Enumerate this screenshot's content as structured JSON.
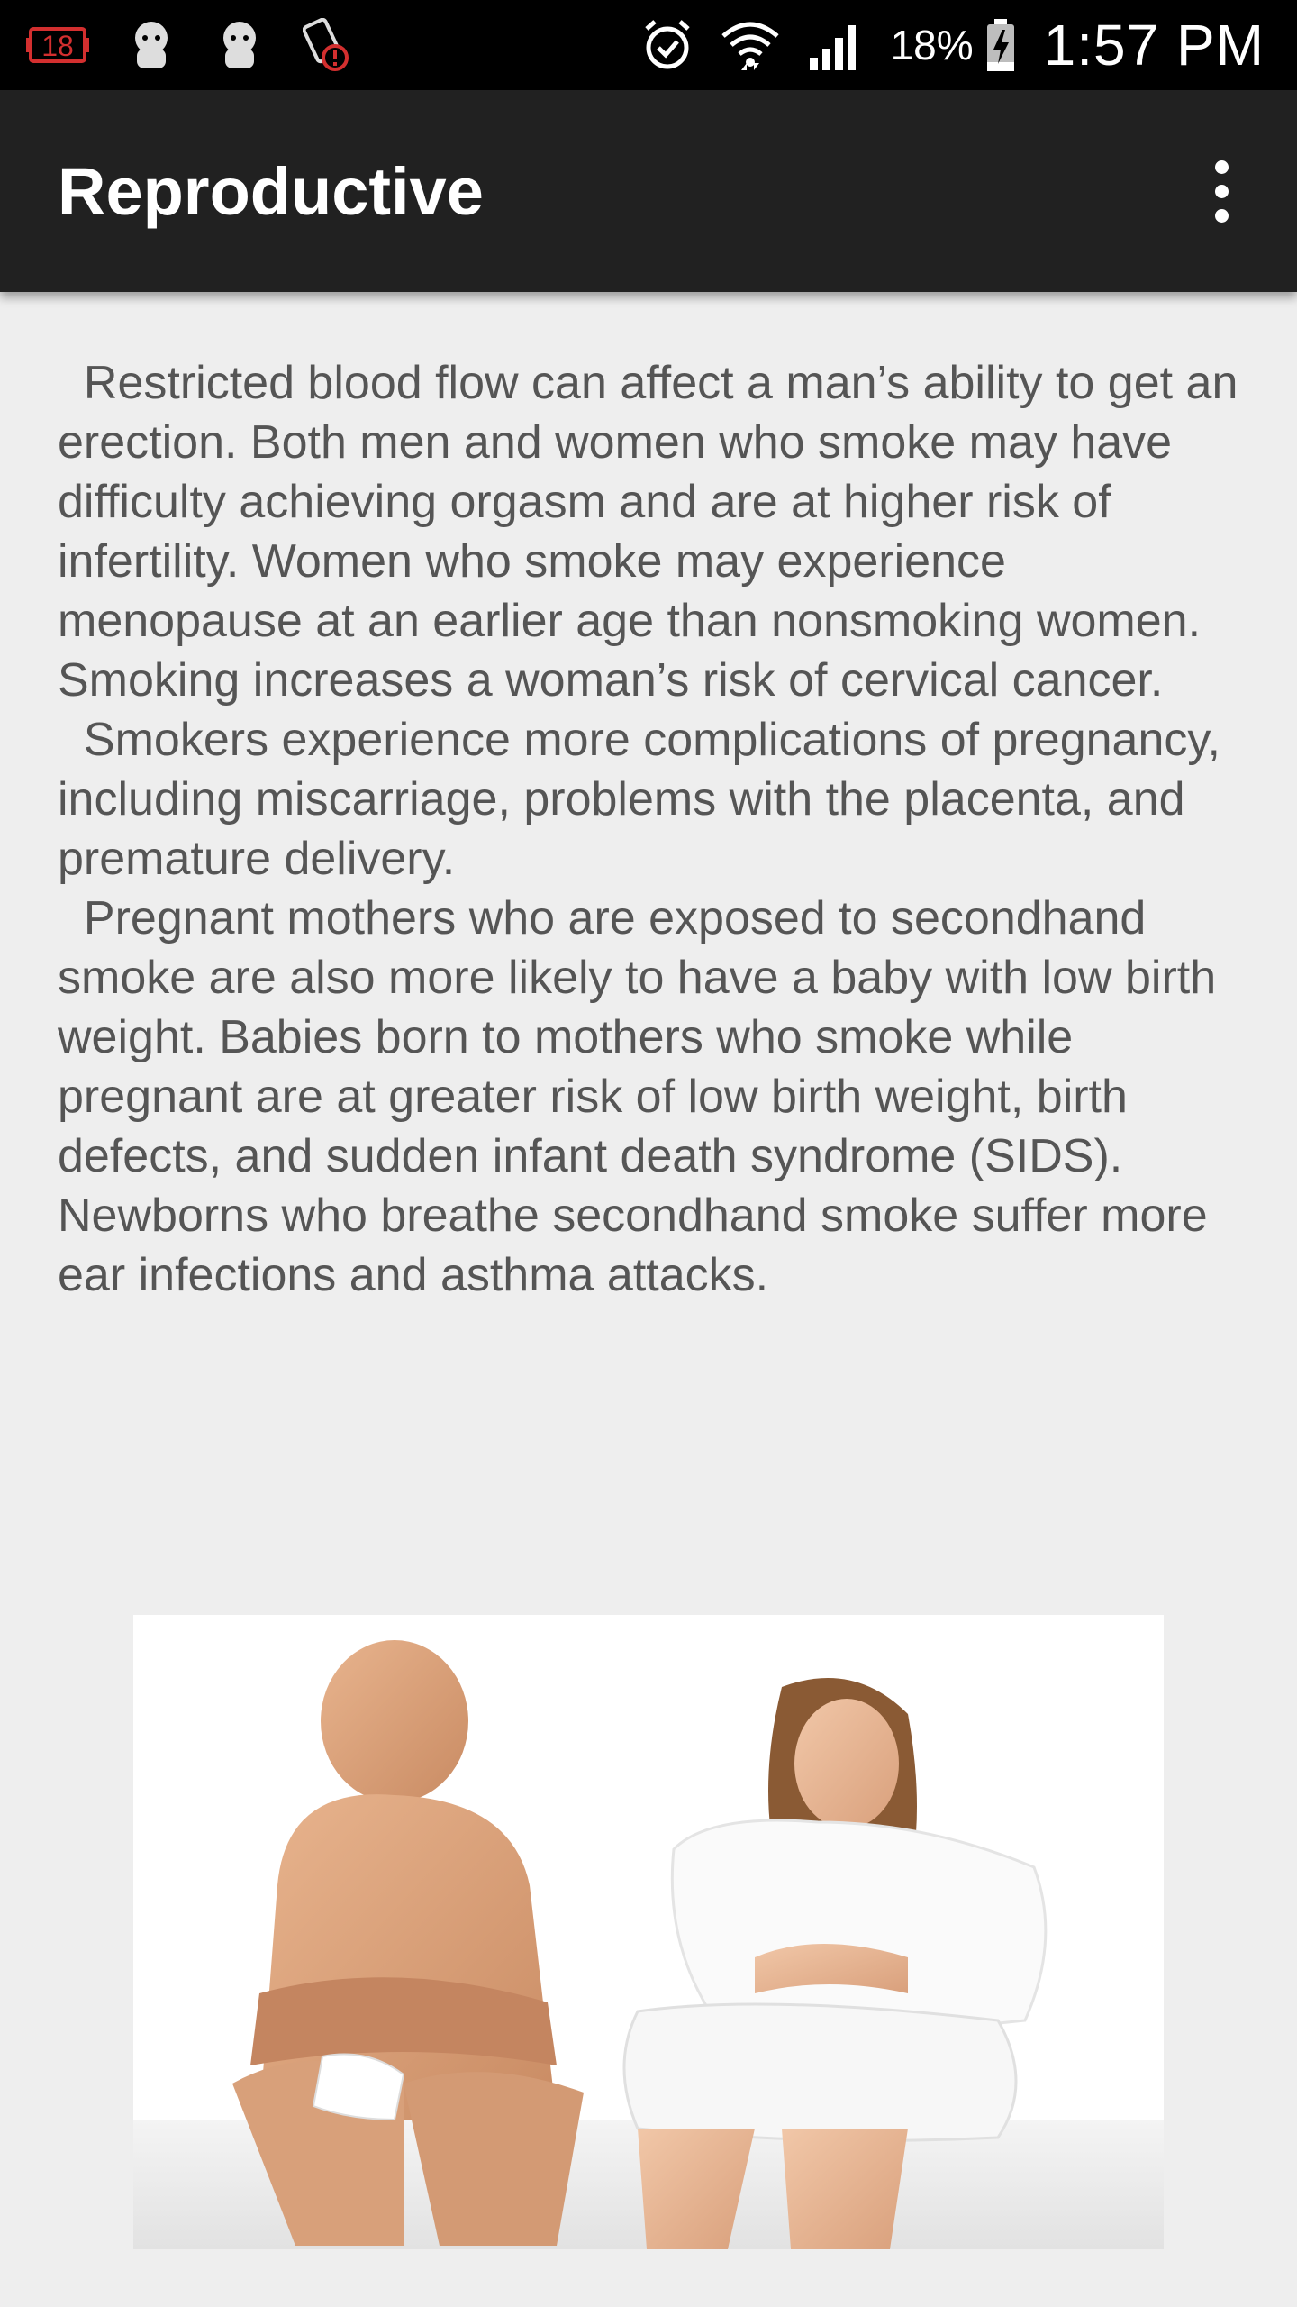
{
  "status_bar": {
    "notification_badge": "18",
    "battery_percent": "18%",
    "time": "1:57 PM"
  },
  "app_bar": {
    "title": "Reproductive"
  },
  "content": {
    "paragraphs": [
      "  Restricted blood flow can affect a man’s ability to get an erection. Both men and women who smoke may have difficulty achieving orgasm and are at higher risk of infertility. Women who smoke may experience menopause at an earlier age than nonsmoking women. Smoking increases a woman’s risk of cervical cancer.",
      "  Smokers experience more complications of pregnancy, including miscarriage, problems with the placenta, and premature delivery.",
      "  Pregnant mothers who are exposed to secondhand smoke are also more likely to have a baby with low birth weight. Babies born to mothers who smoke while pregnant are at greater risk of low birth weight, birth defects, and sudden infant death syndrome (SIDS). Newborns who breathe secondhand smoke suffer more ear infections and asthma attacks."
    ]
  },
  "colors": {
    "status_bar_bg": "#000000",
    "app_bar_bg": "#212121",
    "page_bg": "#eeeeee",
    "body_text": "#555555",
    "badge_red": "#d32f2f"
  },
  "icons": {
    "status_left": [
      "notification-18-icon",
      "person-icon",
      "person-icon",
      "battery-alert-icon"
    ],
    "status_right": [
      "alarm-icon",
      "wifi-icon",
      "signal-icon",
      "battery-charging-icon"
    ],
    "app_bar": "more-vert-icon"
  }
}
